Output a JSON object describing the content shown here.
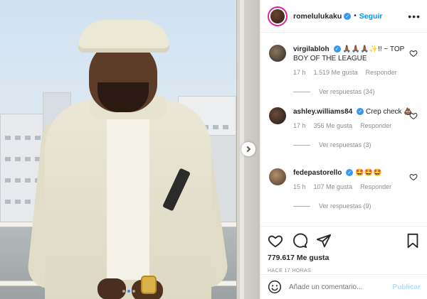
{
  "post": {
    "username": "romelulukaku",
    "follow_label": "Seguir",
    "bullet": "•",
    "more_label": "•••"
  },
  "comments": [
    {
      "username": "virgilabloh",
      "text": "🙏🏾🙏🏾🙏🏾✨!! ~ TOP BOY OF THE LEAGUE",
      "time": "17 h",
      "likes": "1.519 Me gusta",
      "reply_label": "Responder",
      "view_replies": "Ver respuestas (34)"
    },
    {
      "username": "ashley.williams84",
      "text": "Crep check 💩",
      "time": "17 h",
      "likes": "356 Me gusta",
      "reply_label": "Responder",
      "view_replies": "Ver respuestas (3)"
    },
    {
      "username": "fedepastorello",
      "text": "🤩🤩🤩",
      "time": "15 h",
      "likes": "107 Me gusta",
      "reply_label": "Responder",
      "view_replies": "Ver respuestas (9)"
    }
  ],
  "actions": {
    "likes": "779.617 Me gusta",
    "time": "HACE 17 HORAS"
  },
  "add_comment": {
    "placeholder": "Añade un comentario...",
    "publish_label": "Publicar"
  },
  "carousel": {
    "count": 3,
    "active_index": 1
  },
  "colors": {
    "accent": "#0095f6",
    "verified": "#3897f0",
    "publish_disabled": "#b2dffc",
    "muted": "#8e8e8e"
  }
}
